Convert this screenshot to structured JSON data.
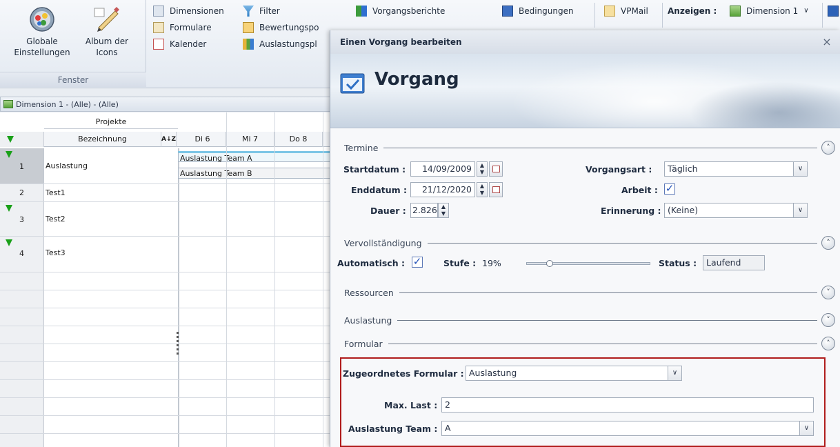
{
  "ribbon": {
    "fenster_group_label": "Fenster",
    "global_settings_label": "Globale\nEinstellungen",
    "icon_album_label": "Album der\nIcons",
    "items": {
      "dimensionen": "Dimensionen",
      "formulare": "Formulare",
      "kalender": "Kalender",
      "filter": "Filter",
      "bewertungspo": "Bewertungspo",
      "auslastungspl": "Auslastungspl",
      "vorgangsberichte": "Vorgangsberichte",
      "bedingungen": "Bedingungen",
      "vpmail": "VPMail"
    },
    "anzeigen_label": "Anzeigen :",
    "anzeigen_value": "Dimension 1"
  },
  "grid": {
    "title": "Dimension 1 - (Alle) - (Alle)",
    "header_group": "Projekte",
    "header_bezeichnung": "Bezeichnung",
    "sort_icon_text": "A↓Z",
    "days": [
      "Di 6",
      "Mi 7",
      "Do 8"
    ],
    "rows": [
      {
        "num": "1",
        "name": "Auslastung"
      },
      {
        "num": "2",
        "name": "Test1"
      },
      {
        "num": "3",
        "name": "Test2"
      },
      {
        "num": "4",
        "name": "Test3"
      }
    ],
    "bars": [
      "Auslastung Team A",
      "Auslastung Team B"
    ]
  },
  "dialog": {
    "title": "Einen Vorgang bearbeiten",
    "close": "×",
    "banner_title": "Vorgang",
    "sections": {
      "termine": "Termine",
      "vervollstaendigung": "Vervollständigung",
      "ressourcen": "Ressourcen",
      "auslastung": "Auslastung",
      "formular": "Formular"
    },
    "toggle_up": "˄",
    "toggle_down": "˅",
    "fields": {
      "startdatum_label": "Startdatum :",
      "startdatum_value": "14/09/2009",
      "enddatum_label": "Enddatum :",
      "enddatum_value": "21/12/2020",
      "dauer_label": "Dauer :",
      "dauer_value": "2.826",
      "vorgangsart_label": "Vorgangsart :",
      "vorgangsart_value": "Täglich",
      "arbeit_label": "Arbeit :",
      "arbeit_checked": true,
      "erinnerung_label": "Erinnerung :",
      "erinnerung_value": "(Keine)",
      "automatisch_label": "Automatisch :",
      "automatisch_checked": true,
      "stufe_label": "Stufe :",
      "stufe_value": "19%",
      "stufe_level": 0.19,
      "status_label": "Status :",
      "status_value": "Laufend",
      "zugeordnetes_formular_label": "Zugeordnetes Formular :",
      "zugeordnetes_formular_value": "Auslastung",
      "max_last_label": "Max. Last :",
      "max_last_value": "2",
      "auslastung_team_label": "Auslastung Team :",
      "auslastung_team_value": "A"
    },
    "check_mark": "✓",
    "select_arrow": "∨",
    "spin_up": "▲",
    "spin_down": "▼"
  }
}
